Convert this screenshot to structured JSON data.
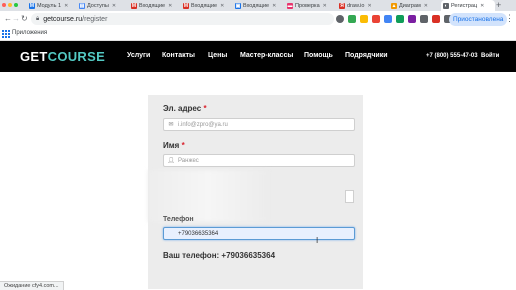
{
  "browser": {
    "tabs": [
      {
        "label": "Модуль 1",
        "favicon_color": "#1a73e8",
        "favicon": "M"
      },
      {
        "label": "Доступы",
        "favicon_color": "#4285f4",
        "favicon": "▤"
      },
      {
        "label": "Входящие",
        "favicon_color": "#d93025",
        "favicon": "M"
      },
      {
        "label": "Входящие",
        "favicon_color": "#d93025",
        "favicon": "M"
      },
      {
        "label": "Входящие",
        "favicon_color": "#1a73e8",
        "favicon": "▣"
      },
      {
        "label": "Проверка",
        "favicon_color": "#e8336d",
        "favicon": "▬"
      },
      {
        "label": "draw.io",
        "favicon_color": "#d93025",
        "favicon": "Я"
      },
      {
        "label": "Диаграм",
        "favicon_color": "#f29900",
        "favicon": "▲"
      },
      {
        "label": "Регистрац",
        "favicon_color": "#5f6368",
        "favicon": "◐"
      }
    ],
    "url_host": "getcourse.ru",
    "url_path": "/register",
    "profile_label": "Приостановлена",
    "bookmarks_label": "Приложения"
  },
  "site": {
    "logo_get": "GET",
    "logo_course": "COURSE",
    "nav": [
      "Услуги",
      "Контакты",
      "Цены",
      "Мастер-классы",
      "Помощь",
      "Подрядчики"
    ],
    "phone": "+7 (800) 555-47-03",
    "login": "Войти"
  },
  "form": {
    "email_label": "Эл. адрес",
    "email_placeholder": "i.info@zpro@ya.ru",
    "name_label": "Имя",
    "name_placeholder": "Ранжес",
    "required_mark": "*",
    "phone_label": "Телефон",
    "phone_value": "+79036635364",
    "your_phone": "Ваш телефон: +79036635364"
  },
  "status_bar": "Ожидание cfy4.com..."
}
